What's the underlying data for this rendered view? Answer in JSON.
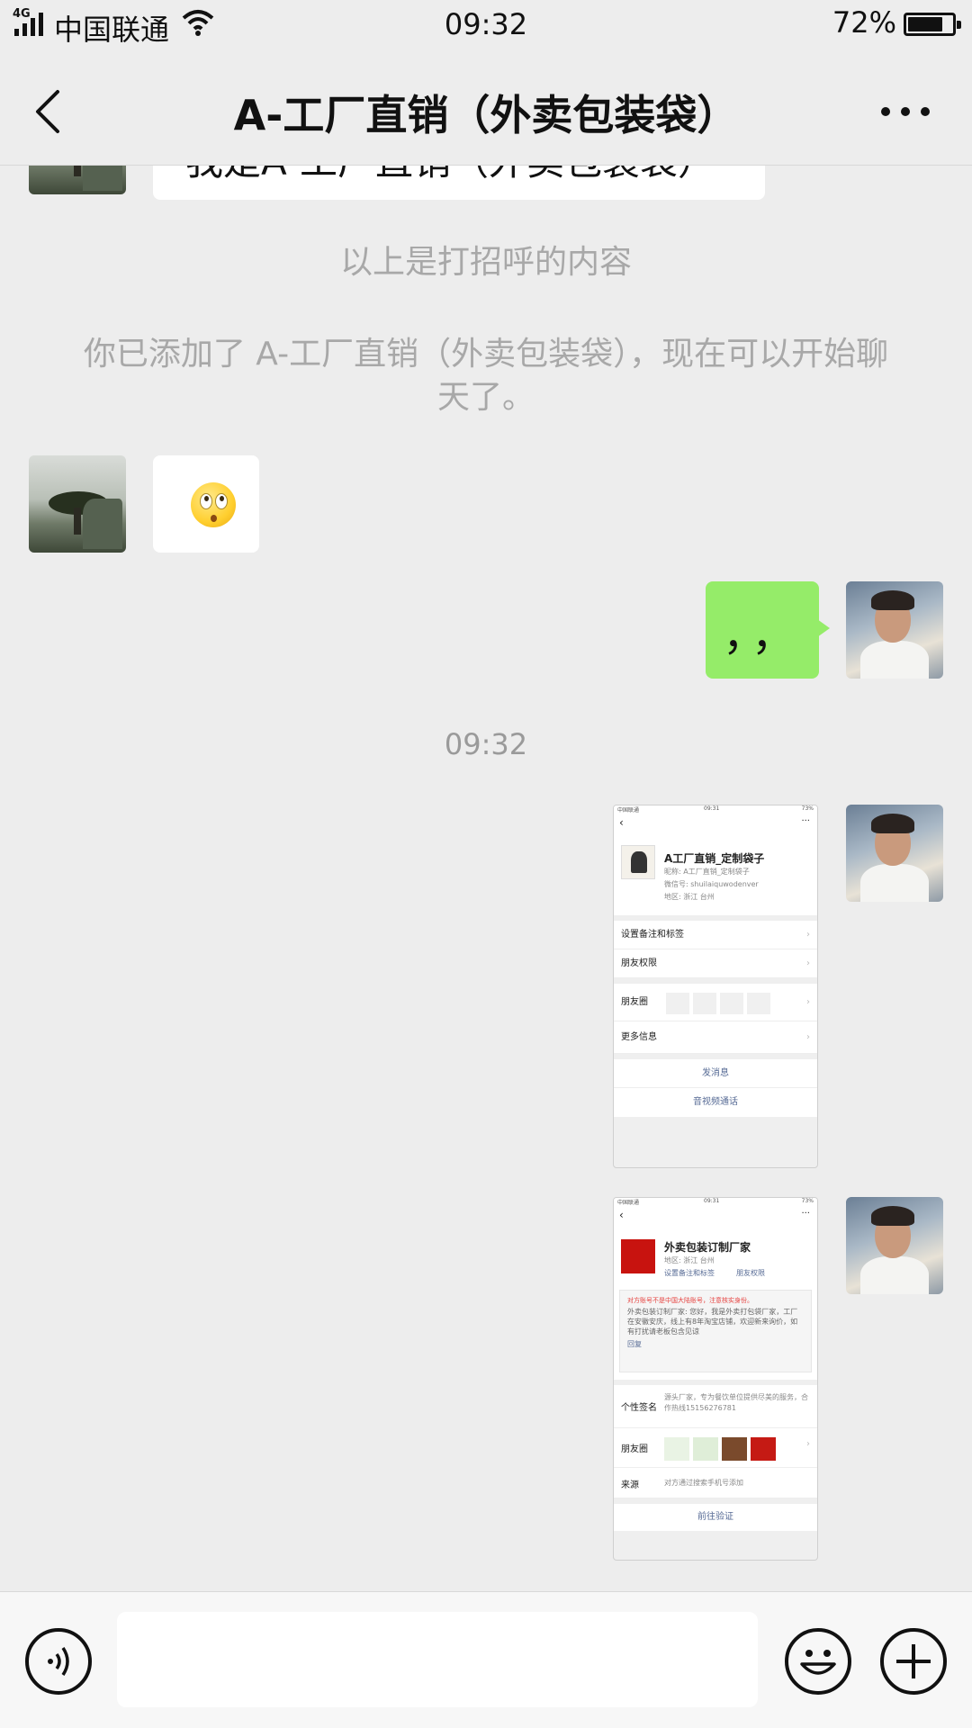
{
  "status_bar": {
    "network": "4G",
    "carrier": "中国联通",
    "time": "09:32",
    "battery": "72%"
  },
  "header": {
    "title": "A-工厂直销（外卖包装袋）"
  },
  "chat": {
    "top_bubble_partial": "我是A-工厂直销（外卖包装袋）",
    "system_greeting": "以上是打招呼的内容",
    "system_added": "你已添加了 A-工厂直销（外卖包装袋），现在可以开始聊天了。",
    "my_message": "，，",
    "timestamp": "09:32",
    "screenshot1": {
      "status_left": "中国联通",
      "status_time": "09:31",
      "status_right": "73%",
      "name": "A工厂直销_定制袋子",
      "nickname": "昵称: A工厂直销_定制袋子",
      "wechat_id": "微信号: shuilaiquwodenver",
      "region": "地区: 浙江 台州",
      "rows": [
        "设置备注和标签",
        "朋友权限",
        "朋友圈",
        "更多信息"
      ],
      "send_message": "发消息",
      "video_call": "音视频通话"
    },
    "screenshot2": {
      "status_left": "中国联通",
      "status_time": "09:31",
      "status_right": "73%",
      "name": "外卖包装订制厂家",
      "region": "地区: 浙江 台州",
      "link_remark": "设置备注和标签",
      "link_permission": "朋友权限",
      "warning": "对方账号不是中国大陆账号，注意核实身份。",
      "greeting": "外卖包装订制厂家: 您好，我是外卖打包袋厂家，工厂在安徽安庆，线上有8年淘宝店铺，欢迎新来询价，如有打扰请老板包含见谅",
      "reply": "回复",
      "signature_label": "个性签名",
      "signature": "源头厂家，专为餐饮单位提供尽美的服务，合作热线15156276781",
      "moments_label": "朋友圈",
      "source_label": "来源",
      "source": "对方通过搜索手机号添加",
      "verify": "前往验证"
    }
  },
  "input_bar": {
    "voice_icon": "voice-icon",
    "emoji_icon": "emoji-icon",
    "plus_icon": "plus-icon"
  },
  "colors": {
    "background": "#ededed",
    "my_bubble": "#95ec69",
    "link": "#576b95"
  }
}
